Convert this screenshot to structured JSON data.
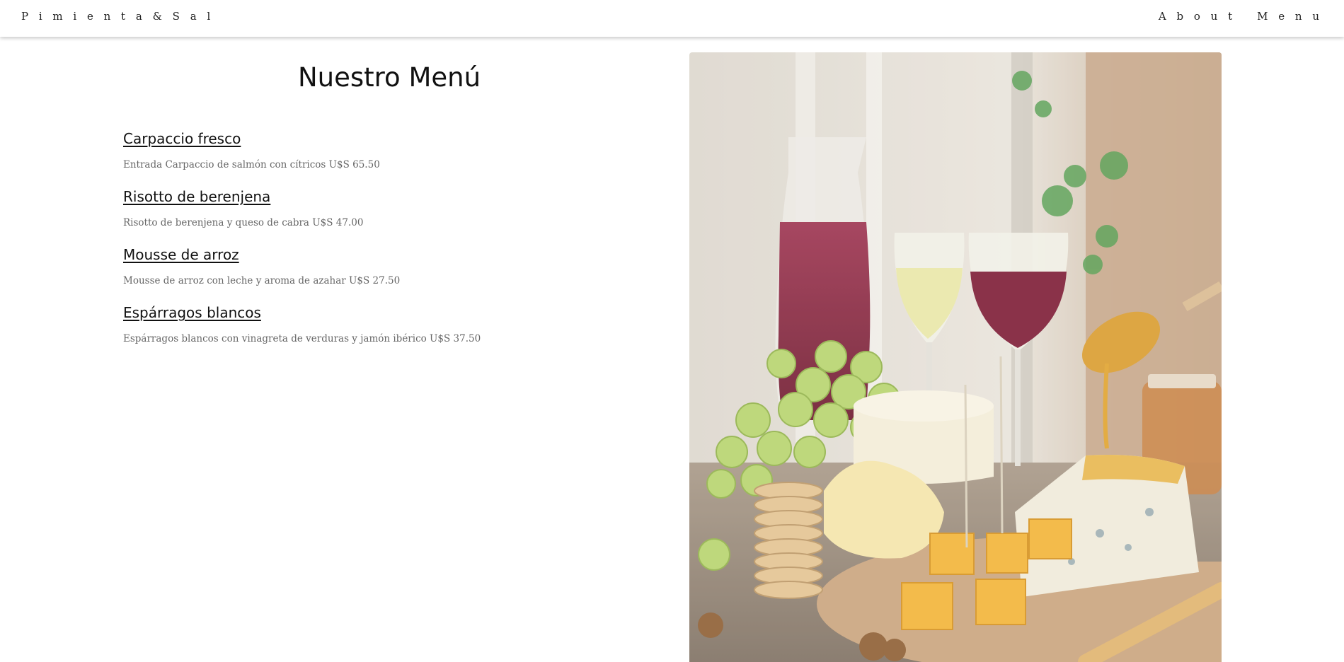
{
  "nav": {
    "brand": "P i m i e n t a   &   S a l",
    "links": [
      "A b o u t",
      "M e n u"
    ]
  },
  "menu": {
    "title": "Nuestro Menú",
    "dishes": [
      {
        "name": "Carpaccio fresco",
        "description": "Entrada Carpaccio de salmón con cítricos U$S 65.50"
      },
      {
        "name": "Risotto de berenjena",
        "description": "Risotto de berenjena y queso de cabra U$S 47.00"
      },
      {
        "name": "Mousse de arroz",
        "description": "Mousse de arroz con leche y aroma de azahar U$S 27.50"
      },
      {
        "name": "Espárragos blancos",
        "description": "Espárragos blancos con vinagreta de verduras y jamón ibérico U$S 37.50"
      }
    ]
  },
  "photo": {
    "subject": "wine, grapes, cheese and honey still life",
    "colors": {
      "wine": "#8a1e3a",
      "grapes": "#a9c94a",
      "cheese": "#f2b233",
      "honey": "#e0a12a",
      "board": "#c9a27a"
    }
  }
}
